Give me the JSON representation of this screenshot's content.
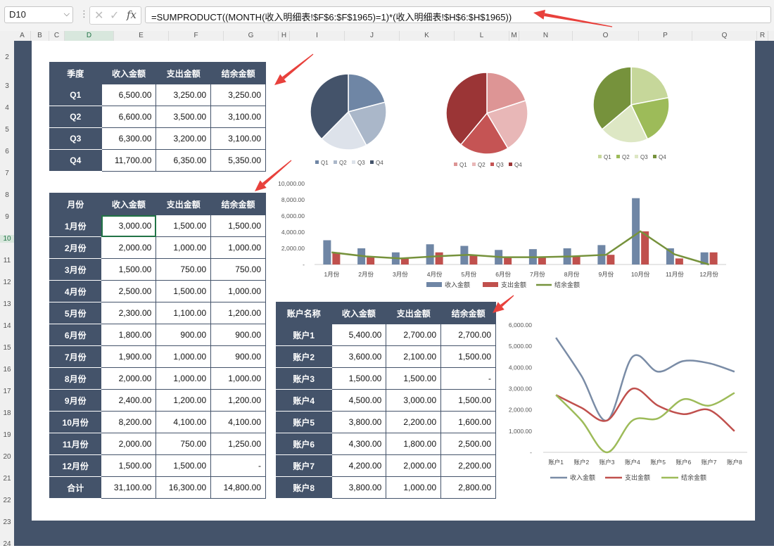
{
  "formula_bar": {
    "name_box": "D10",
    "formula": "=SUMPRODUCT((MONTH(收入明细表!$F$6:$F$1965)=1)*(收入明细表!$H$6:$H$1965))"
  },
  "columns": [
    "A",
    "B",
    "C",
    "D",
    "E",
    "F",
    "G",
    "H",
    "I",
    "J",
    "K",
    "L",
    "M",
    "N",
    "O",
    "P",
    "Q",
    "R"
  ],
  "rows": [
    "2",
    "3",
    "4",
    "5",
    "6",
    "7",
    "8",
    "9",
    "10",
    "11",
    "12",
    "13",
    "14",
    "15",
    "16",
    "17",
    "18",
    "19",
    "20",
    "21",
    "22",
    "23",
    "24"
  ],
  "quarter_table": {
    "headers": [
      "季度",
      "收入金额",
      "支出金额",
      "结余金额"
    ],
    "rows": [
      [
        "Q1",
        "6,500.00",
        "3,250.00",
        "3,250.00"
      ],
      [
        "Q2",
        "6,600.00",
        "3,500.00",
        "3,100.00"
      ],
      [
        "Q3",
        "6,300.00",
        "3,200.00",
        "3,100.00"
      ],
      [
        "Q4",
        "11,700.00",
        "6,350.00",
        "5,350.00"
      ]
    ]
  },
  "month_table": {
    "headers": [
      "月份",
      "收入金额",
      "支出金额",
      "结余金额"
    ],
    "rows": [
      [
        "1月份",
        "3,000.00",
        "1,500.00",
        "1,500.00"
      ],
      [
        "2月份",
        "2,000.00",
        "1,000.00",
        "1,000.00"
      ],
      [
        "3月份",
        "1,500.00",
        "750.00",
        "750.00"
      ],
      [
        "4月份",
        "2,500.00",
        "1,500.00",
        "1,000.00"
      ],
      [
        "5月份",
        "2,300.00",
        "1,100.00",
        "1,200.00"
      ],
      [
        "6月份",
        "1,800.00",
        "900.00",
        "900.00"
      ],
      [
        "7月份",
        "1,900.00",
        "1,000.00",
        "900.00"
      ],
      [
        "8月份",
        "2,000.00",
        "1,000.00",
        "1,000.00"
      ],
      [
        "9月份",
        "2,400.00",
        "1,200.00",
        "1,200.00"
      ],
      [
        "10月份",
        "8,200.00",
        "4,100.00",
        "4,100.00"
      ],
      [
        "11月份",
        "2,000.00",
        "750.00",
        "1,250.00"
      ],
      [
        "12月份",
        "1,500.00",
        "1,500.00",
        "-"
      ],
      [
        "合计",
        "31,100.00",
        "16,300.00",
        "14,800.00"
      ]
    ]
  },
  "account_table": {
    "headers": [
      "账户名称",
      "收入金额",
      "支出金额",
      "结余金额"
    ],
    "rows": [
      [
        "账户1",
        "5,400.00",
        "2,700.00",
        "2,700.00"
      ],
      [
        "账户2",
        "3,600.00",
        "2,100.00",
        "1,500.00"
      ],
      [
        "账户3",
        "1,500.00",
        "1,500.00",
        "-"
      ],
      [
        "账户4",
        "4,500.00",
        "3,000.00",
        "1,500.00"
      ],
      [
        "账户5",
        "3,800.00",
        "2,200.00",
        "1,600.00"
      ],
      [
        "账户6",
        "4,300.00",
        "1,800.00",
        "2,500.00"
      ],
      [
        "账户7",
        "4,200.00",
        "2,000.00",
        "2,200.00"
      ],
      [
        "账户8",
        "3,800.00",
        "1,000.00",
        "2,800.00"
      ]
    ]
  },
  "chart_data": [
    {
      "type": "pie",
      "categories": [
        "Q1",
        "Q2",
        "Q3",
        "Q4"
      ],
      "values": [
        6500,
        6600,
        6300,
        11700
      ],
      "colors": [
        "#6f86a5",
        "#aab7c9",
        "#dde2ea",
        "#44536a"
      ],
      "legend": "bottom"
    },
    {
      "type": "pie",
      "categories": [
        "Q1",
        "Q2",
        "Q3",
        "Q4"
      ],
      "values": [
        3250,
        3500,
        3200,
        6350
      ],
      "colors": [
        "#dd9595",
        "#e8b7b7",
        "#c55454",
        "#9b3536"
      ],
      "legend": "bottom"
    },
    {
      "type": "pie",
      "categories": [
        "Q1",
        "Q2",
        "Q3",
        "Q4"
      ],
      "values": [
        3250,
        3100,
        3100,
        5350
      ],
      "colors": [
        "#c6d79a",
        "#9dbb59",
        "#dde7c4",
        "#76923c"
      ],
      "legend": "bottom"
    },
    {
      "type": "bar",
      "categories": [
        "1月份",
        "2月份",
        "3月份",
        "4月份",
        "5月份",
        "6月份",
        "7月份",
        "8月份",
        "9月份",
        "10月份",
        "11月份",
        "12月份"
      ],
      "series": [
        {
          "name": "收入金额",
          "kind": "bar",
          "color": "#6f86a5",
          "values": [
            3000,
            2000,
            1500,
            2500,
            2300,
            1800,
            1900,
            2000,
            2400,
            8200,
            2000,
            1500
          ]
        },
        {
          "name": "支出金额",
          "kind": "bar",
          "color": "#c0504d",
          "values": [
            1500,
            1000,
            750,
            1500,
            1100,
            900,
            1000,
            1000,
            1200,
            4100,
            750,
            1500
          ]
        },
        {
          "name": "结余金额",
          "kind": "line",
          "color": "#76923c",
          "values": [
            1500,
            1000,
            750,
            1000,
            1200,
            900,
            900,
            1000,
            1200,
            4100,
            1250,
            0
          ]
        }
      ],
      "yticks": [
        "-",
        "2,000.00",
        "4,000.00",
        "6,000.00",
        "8,000.00",
        "10,000.00"
      ],
      "ylim": [
        0,
        10000
      ],
      "legend": "bottom"
    },
    {
      "type": "line",
      "categories": [
        "账户1",
        "账户2",
        "账户3",
        "账户4",
        "账户5",
        "账户6",
        "账户7",
        "账户8"
      ],
      "series": [
        {
          "name": "收入金额",
          "color": "#7a8ca6",
          "values": [
            5400,
            3600,
            1500,
            4500,
            3800,
            4300,
            4200,
            3800
          ]
        },
        {
          "name": "支出金额",
          "color": "#c0504d",
          "values": [
            2700,
            2100,
            1500,
            3000,
            2200,
            1800,
            2000,
            1000
          ]
        },
        {
          "name": "结余金额",
          "color": "#9dbb59",
          "values": [
            2700,
            1500,
            0,
            1500,
            1600,
            2500,
            2200,
            2800
          ]
        }
      ],
      "yticks": [
        "-",
        "1,000.00",
        "2,000.00",
        "3,000.00",
        "4,000.00",
        "5,000.00",
        "6,000.00"
      ],
      "ylim": [
        0,
        6000
      ],
      "smooth": true,
      "legend": "bottom"
    }
  ],
  "annotation": {
    "arrow_color": "#e8413c"
  }
}
